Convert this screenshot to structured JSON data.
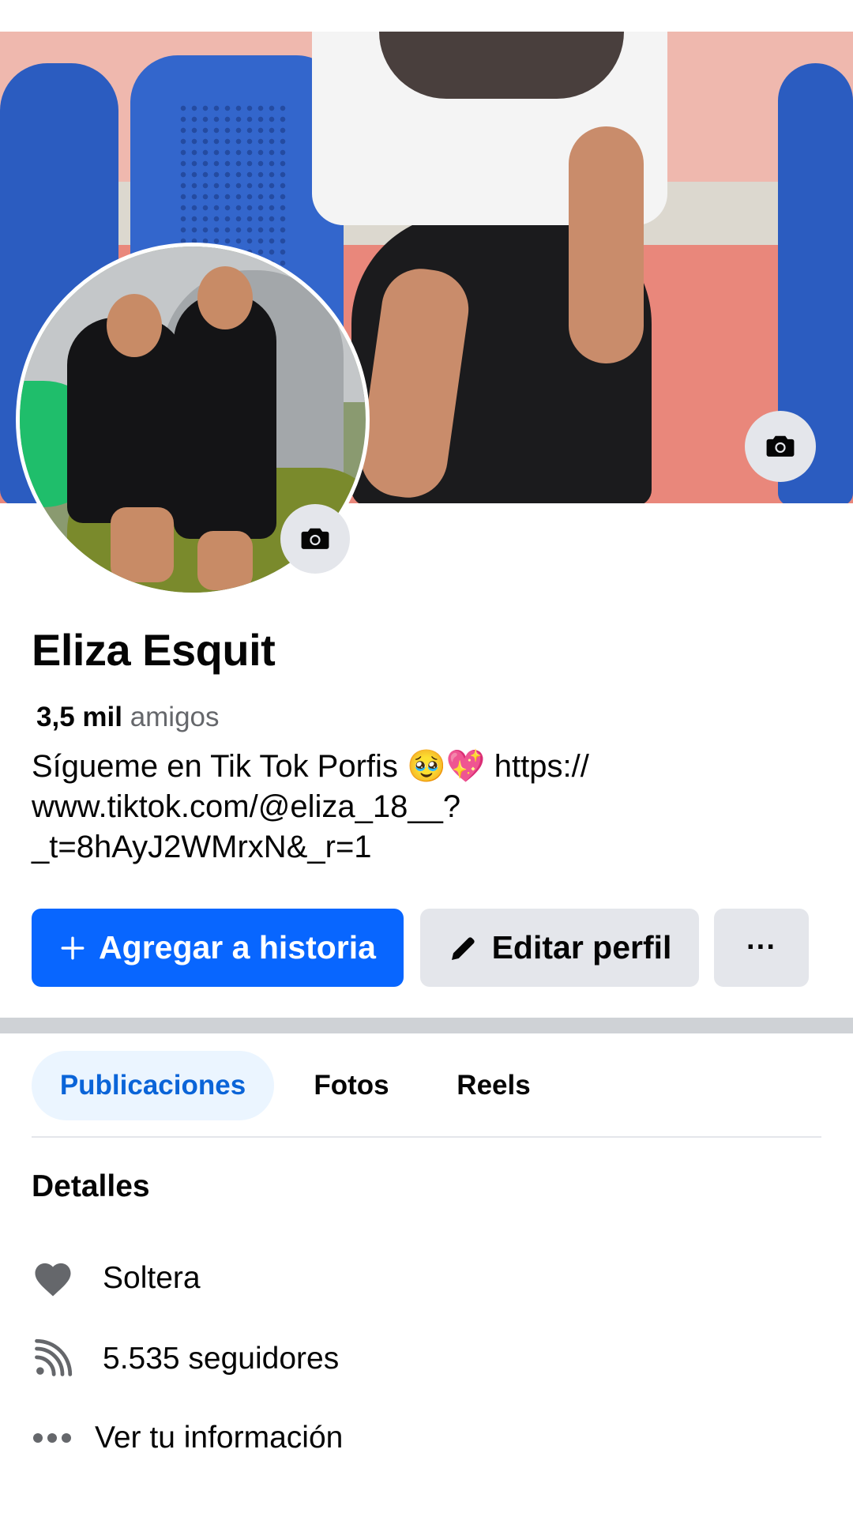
{
  "profile": {
    "name": "Eliza Esquit",
    "friends_count": "3,5 mil",
    "friends_label": "amigos",
    "bio": "Sígueme en Tik Tok Porfis 🥹💖 https://\nwww.tiktok.com/@eliza_18__?\n_t=8hAyJ2WMrxN&_r=1"
  },
  "icons": {
    "cover_camera": "camera-icon",
    "avatar_camera": "camera-icon",
    "add_story": "plus-icon",
    "edit_profile": "pencil-icon",
    "more": "more-icon",
    "relationship": "heart-icon",
    "followers": "rss-icon",
    "info": "ellipsis-icon"
  },
  "actions": {
    "add_story_label": "Agregar a historia",
    "edit_profile_label": "Editar perfil",
    "more_label": "···"
  },
  "tabs": [
    {
      "label": "Publicaciones",
      "active": true
    },
    {
      "label": "Fotos",
      "active": false
    },
    {
      "label": "Reels",
      "active": false
    }
  ],
  "details": {
    "title": "Detalles",
    "relationship": "Soltera",
    "followers": "5.535 seguidores",
    "info_link": "Ver tu información"
  },
  "colors": {
    "primary": "#0866ff",
    "secondary_button": "#e4e6eb",
    "active_tab_bg": "#ebf5ff",
    "active_tab_text": "#0a64d8",
    "muted_text": "#65676b",
    "icon_gray": "#65676b"
  }
}
